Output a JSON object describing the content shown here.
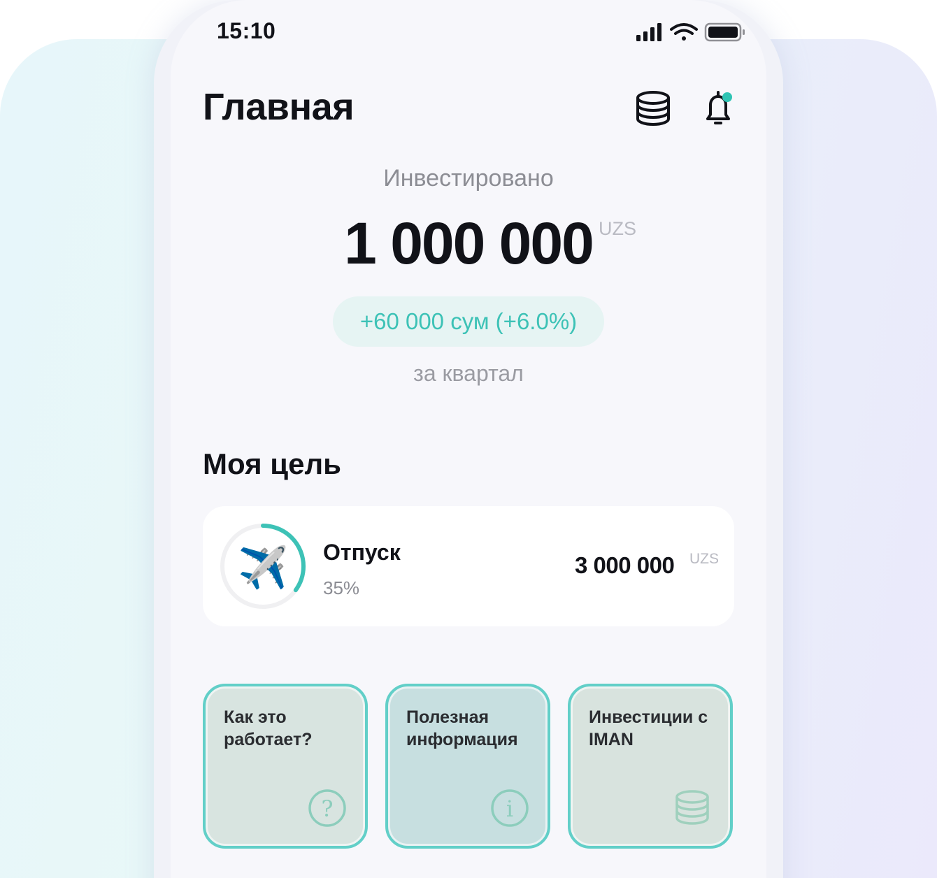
{
  "status_bar": {
    "time": "15:10",
    "icons": [
      "signal-icon",
      "wifi-icon",
      "battery-icon"
    ]
  },
  "header": {
    "title": "Главная",
    "actions": [
      "coins-icon",
      "bell-icon"
    ],
    "notification_dot": true
  },
  "summary": {
    "label": "Инвестировано",
    "amount": "1 000 000",
    "currency": "UZS",
    "change": "+60 000 сум (+6.0%)",
    "period": "за квартал"
  },
  "goal": {
    "heading": "Моя цель",
    "name": "Отпуск",
    "emoji": "✈️",
    "progress_label": "35%",
    "progress": 0.35,
    "target_amount": "3 000 000",
    "currency": "UZS"
  },
  "tiles": [
    {
      "label": "Как это работает?",
      "icon": "question-icon"
    },
    {
      "label": "Полезная информация",
      "icon": "info-icon"
    },
    {
      "label": "Инвестиции с IMAN",
      "icon": "coins-icon"
    }
  ],
  "colors": {
    "accent": "#3dc2b6",
    "tile_border": "#62cfc8",
    "pill_background": "#e6f4f3",
    "notification_dot": "#2fc4b4"
  }
}
